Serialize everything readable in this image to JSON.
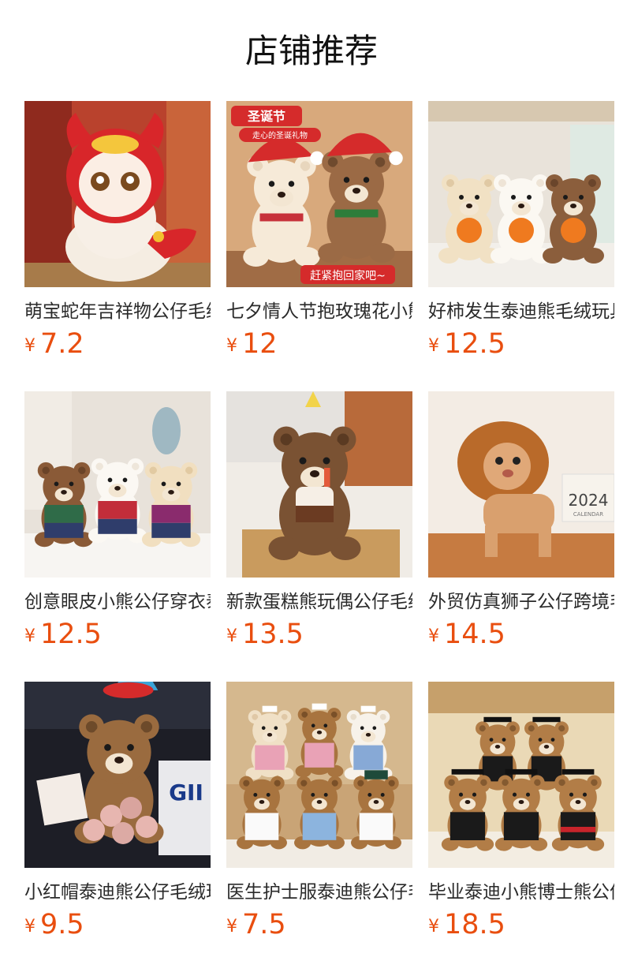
{
  "section_title": "店铺推荐",
  "currency": "¥",
  "products": [
    {
      "name": "萌宝蛇年吉祥物公仔毛绒玩具",
      "price": "7.2",
      "image_desc": "red-snake-mascot-plush"
    },
    {
      "name": "七夕情人节抱玫瑰花小熊公仔",
      "price": "12",
      "image_desc": "christmas-bear-pair",
      "image_text": {
        "badge": "圣诞节",
        "sub": "走心的圣诞礼物",
        "bottom": "赶紧抱回家吧~"
      }
    },
    {
      "name": "好柿发生泰迪熊毛绒玩具公仔",
      "price": "12.5",
      "image_desc": "persimmon-teddy-trio"
    },
    {
      "name": "创意眼皮小熊公仔穿衣泰迪熊",
      "price": "12.5",
      "image_desc": "dressed-bear-trio"
    },
    {
      "name": "新款蛋糕熊玩偶公仔毛绒玩具",
      "price": "13.5",
      "image_desc": "cake-bear-in-basket"
    },
    {
      "name": "外贸仿真狮子公仔跨境毛绒玩具",
      "price": "14.5",
      "image_desc": "realistic-lion-plush",
      "image_text": {
        "calendar_year": "2024",
        "calendar_sub": "CALENDAR"
      }
    },
    {
      "name": "小红帽泰迪熊公仔毛绒玩具",
      "price": "9.5",
      "image_desc": "bear-with-rose-bouquet",
      "image_text": {
        "bag": "GII"
      }
    },
    {
      "name": "医生护士服泰迪熊公仔毛绒玩具",
      "price": "7.5",
      "image_desc": "doctor-nurse-bears"
    },
    {
      "name": "毕业泰迪小熊博士熊公仔",
      "price": "18.5",
      "image_desc": "graduation-bears"
    }
  ],
  "colors": {
    "price": "#e94e0f",
    "title": "#111111"
  }
}
